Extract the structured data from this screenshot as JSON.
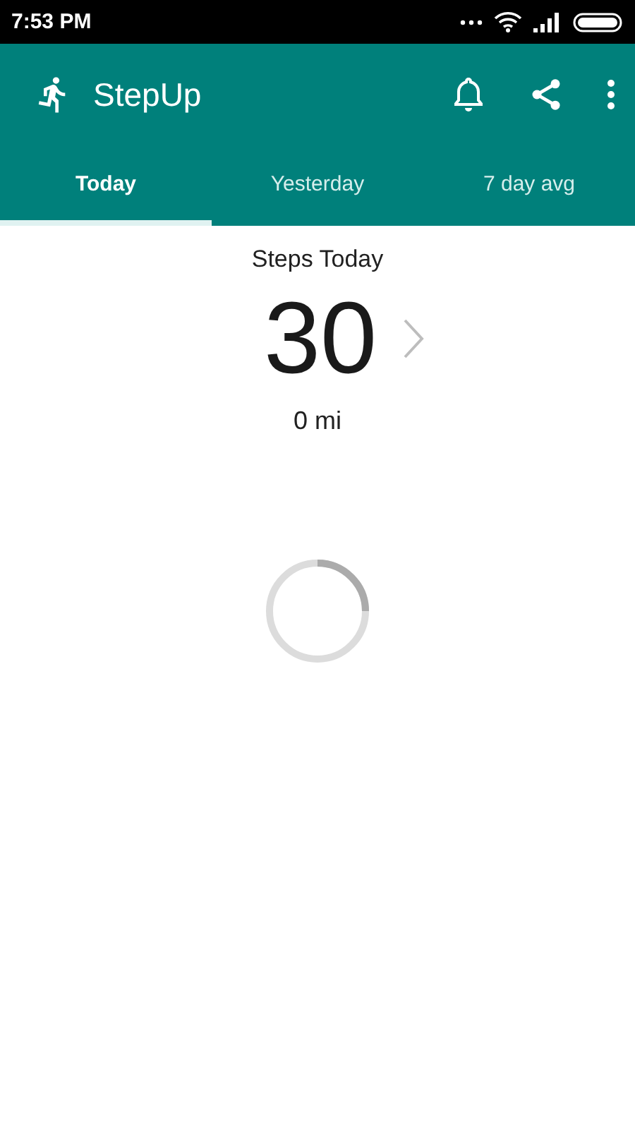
{
  "status_bar": {
    "time": "7:53 PM"
  },
  "app_bar": {
    "title": "StepUp"
  },
  "tabs": [
    {
      "label": "Today",
      "selected": true
    },
    {
      "label": "Yesterday",
      "selected": false
    },
    {
      "label": "7 day avg",
      "selected": false
    }
  ],
  "summary": {
    "label": "Steps Today",
    "value": "30",
    "distance": "0 mi"
  }
}
